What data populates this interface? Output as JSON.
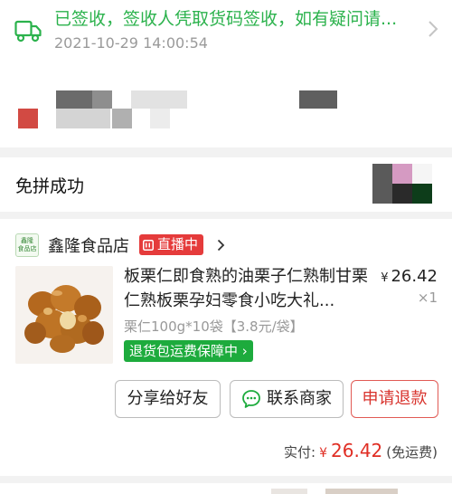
{
  "logistics": {
    "status": "已签收，签收人凭取货码签收，如有疑问请...",
    "time": "2021-10-29 14:00:54",
    "icon": "truck-icon",
    "accent": "#2bb24c"
  },
  "group": {
    "title": "免拼成功"
  },
  "order": {
    "store": {
      "logo_text": "鑫隆\n食品店",
      "name": "鑫隆食品店",
      "live_label": "直播中"
    },
    "product": {
      "title": "板栗仁即食熟的油栗子仁熟制甘栗仁熟板栗孕妇零食小吃大礼...",
      "price_symbol": "¥",
      "price": "26.42",
      "quantity": "×1",
      "spec": "栗仁100g*10袋【3.8元/袋】",
      "guarantee": "退货包运费保障中 ›"
    },
    "buttons": {
      "share": "分享给好友",
      "contact": "联系商家",
      "refund": "申请退款"
    },
    "total": {
      "label": "实付:",
      "symbol": "¥",
      "amount": "26.42",
      "note": "(免运费)"
    },
    "accent_red": "#e02e24",
    "accent_green": "#1dab3d"
  }
}
